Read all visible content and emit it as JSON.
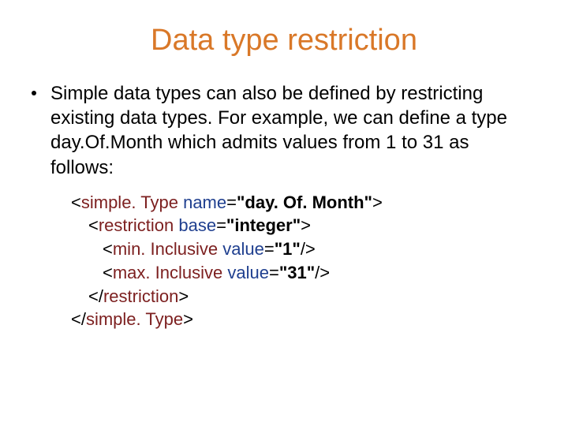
{
  "title": "Data type restriction",
  "bullet": {
    "t1": "Simple data types can also be defined by restricting existing data types. For example, we can define a type ",
    "type_name": "day.Of.Month",
    "t2": " which admits values from 1 to 31 as follows:"
  },
  "code": {
    "l1": {
      "open": "<",
      "tag": "simple. Type ",
      "attr": "name",
      "eq": "=",
      "val": "\"day. Of. Month\"",
      "close": ">"
    },
    "l2": {
      "open": "<",
      "tag": "restriction ",
      "attr": "base",
      "eq": "=",
      "val": "\"integer\"",
      "close": ">"
    },
    "l3": {
      "open": "<",
      "tag": "min. Inclusive ",
      "attr": "value",
      "eq": "=",
      "val": "\"1\"",
      "close": "/>"
    },
    "l4": {
      "open": "<",
      "tag": "max. Inclusive ",
      "attr": "value",
      "eq": "=",
      "val": "\"31\"",
      "close": "/>"
    },
    "l5": {
      "open": "</",
      "tag": "restriction",
      "close": ">"
    },
    "l6": {
      "open": "</",
      "tag": "simple. Type",
      "close": ">"
    }
  }
}
